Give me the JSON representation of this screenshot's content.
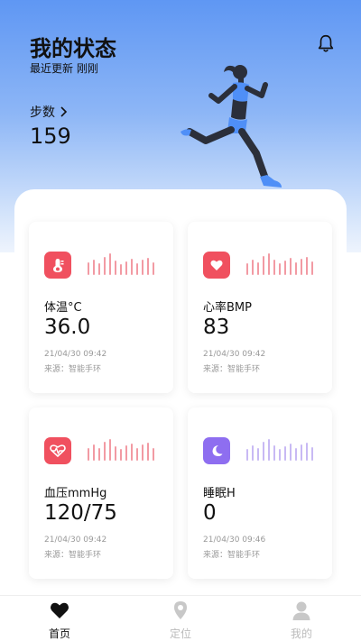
{
  "header": {
    "title": "我的状态",
    "subtitle": "最近更新 刚刚",
    "steps_label": "步数",
    "steps_value": "159",
    "bell_icon": "bell-icon"
  },
  "cards": [
    {
      "label": "体温°C",
      "value": "36.0",
      "timestamp": "21/04/30 09:42",
      "source": "来源：智能手环",
      "icon": "thermometer-icon",
      "color": "#f0505f"
    },
    {
      "label": "心率BMP",
      "value": "83",
      "timestamp": "21/04/30 09:42",
      "source": "来源：智能手环",
      "icon": "heart-icon",
      "color": "#f0505f"
    },
    {
      "label": "血压mmHg",
      "value": "120/75",
      "timestamp": "21/04/30 09:42",
      "source": "来源：智能手环",
      "icon": "pulse-icon",
      "color": "#f0505f"
    },
    {
      "label": "睡眠H",
      "value": "0",
      "timestamp": "21/04/30 09:46",
      "source": "来源：智能手环",
      "icon": "moon-icon",
      "color": "#8e6ef0"
    }
  ],
  "tabs": [
    {
      "label": "首页",
      "icon": "heart-icon",
      "active": true
    },
    {
      "label": "定位",
      "icon": "location-pin-icon",
      "active": false
    },
    {
      "label": "我的",
      "icon": "user-icon",
      "active": false
    }
  ],
  "colors": {
    "hero_top": "#5f97f3",
    "accent_red": "#f0505f",
    "accent_purple": "#8e6ef0"
  }
}
